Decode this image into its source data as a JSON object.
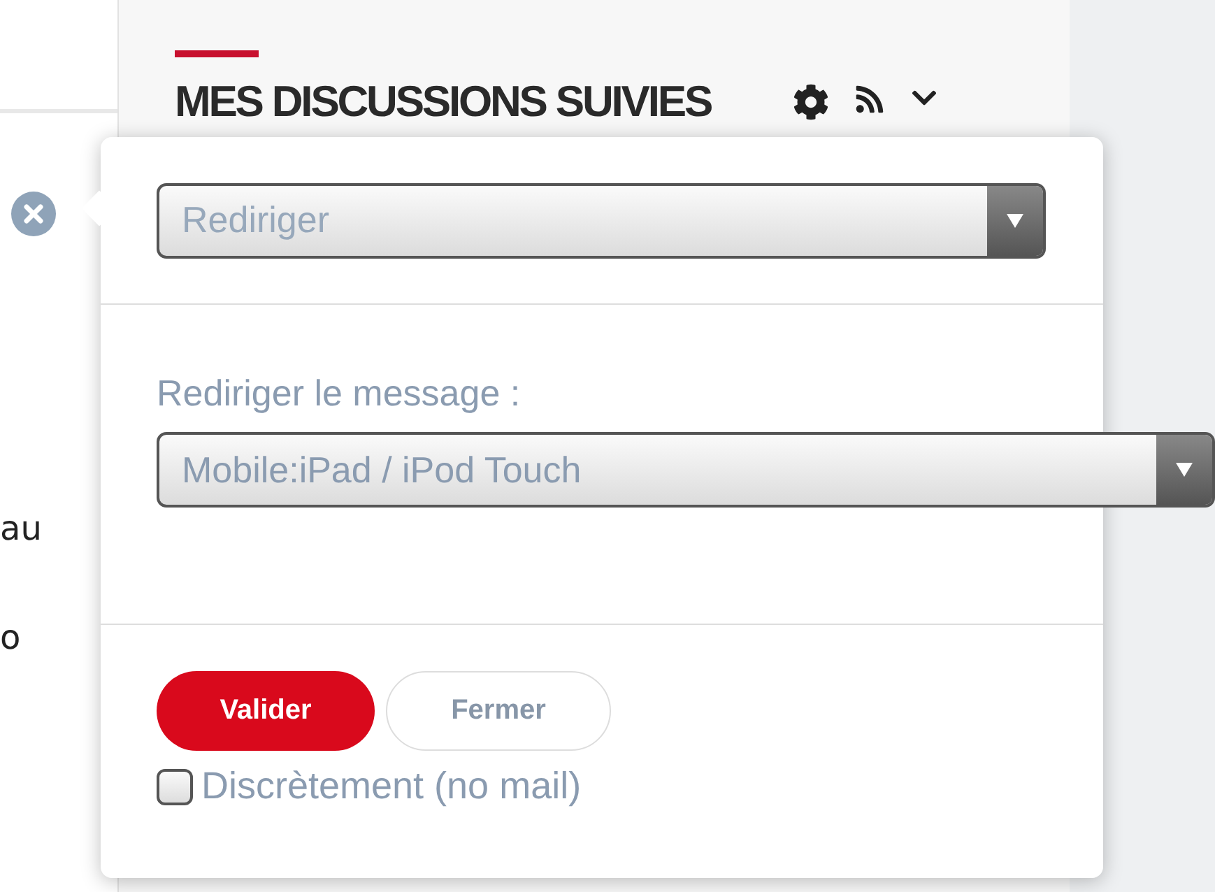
{
  "background_text": [
    "au",
    "o"
  ],
  "panel": {
    "title": "MES DISCUSSIONS SUIVIES"
  },
  "popup": {
    "action_select": {
      "placeholder": "Rediriger"
    },
    "redirect_label": "Rediriger le message :",
    "target_select": {
      "value": "Mobile:iPad / iPod Touch"
    },
    "buttons": [
      {
        "label": "Valider",
        "kind": "primary"
      },
      {
        "label": "Fermer",
        "kind": "secondary"
      }
    ],
    "silent": {
      "label": "Discrètement (no mail)",
      "checked": false
    }
  }
}
